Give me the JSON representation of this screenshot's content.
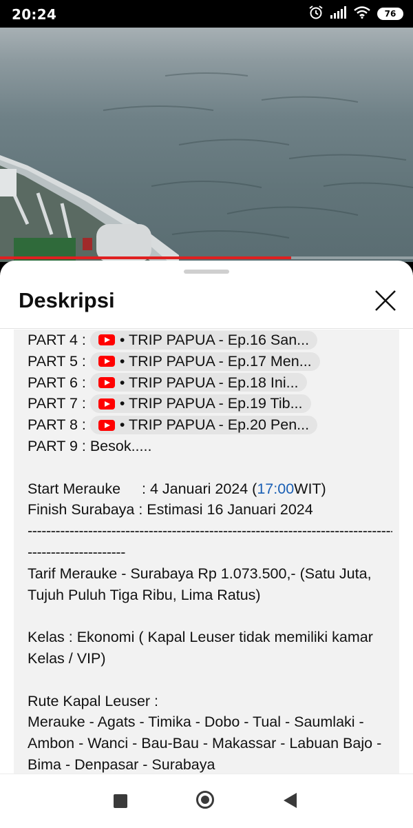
{
  "status_bar": {
    "time": "20:24",
    "battery": "76"
  },
  "video": {
    "progress_percent": 70.5
  },
  "sheet": {
    "title": "Deskripsi"
  },
  "parts": [
    {
      "label": "PART 4 :",
      "link": "• TRIP PAPUA - Ep.16 San..."
    },
    {
      "label": "PART 5 :",
      "link": "• TRIP PAPUA - Ep.17 Men..."
    },
    {
      "label": "PART 6 :",
      "link": "• TRIP PAPUA - Ep.18 Ini..."
    },
    {
      "label": "PART 7 :",
      "link": "• TRIP PAPUA - Ep.19 Tib..."
    },
    {
      "label": "PART 8 :",
      "link": "• TRIP PAPUA - Ep.20 Pen..."
    }
  ],
  "part9": "PART 9 : Besok.....",
  "start": {
    "label": "Start Merauke",
    "sep": ": 4 Januari 2024 (",
    "time": "17:00",
    "tail": " WIT)"
  },
  "finish": "Finish Surabaya : Estimasi 16 Januari 2024",
  "divider1": "--------------------------------------------------------------------------------",
  "divider2": "---------------------",
  "tarif": "Tarif Merauke - Surabaya Rp 1.073.500,- (Satu Juta, Tujuh Puluh Tiga Ribu, Lima Ratus)",
  "kelas": "Kelas : Ekonomi ( Kapal Leuser tidak memiliki kamar Kelas / VIP)",
  "rute_title": "Rute Kapal Leuser :",
  "rute": "Merauke - Agats - Timika - Dobo - Tual - Saumlaki - Ambon - Wanci - Bau-Bau - Makassar - Labuan Bajo - Bima - Denpasar - Surabaya",
  "colors": {
    "link": "#1a5fb4",
    "youtube_red": "#ff0000",
    "progress": "#e02020"
  },
  "icons": [
    "alarm-icon",
    "signal-icon",
    "wifi-icon",
    "battery-icon",
    "close-icon",
    "youtube-icon",
    "recents-icon",
    "home-icon",
    "back-icon"
  ]
}
